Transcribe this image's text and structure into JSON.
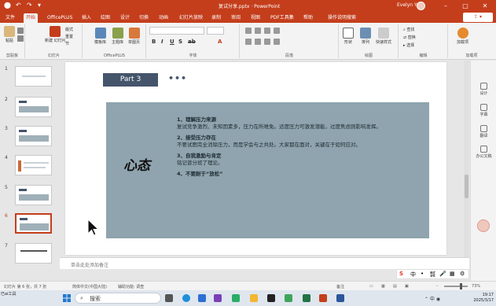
{
  "titlebar": {
    "doc_title": "复试分享.pptx  ·  PowerPoint",
    "user": "Evelyn Yu"
  },
  "tabs": [
    "文件",
    "开始",
    "OfficePLUS",
    "插入",
    "绘图",
    "设计",
    "切换",
    "动画",
    "幻灯片放映",
    "录制",
    "审阅",
    "视图",
    "PDF工具集",
    "帮助",
    "操作说明搜索"
  ],
  "active_tab": "开始",
  "ribbon": {
    "groups": {
      "clipboard": "剪贴板",
      "slides": "幻灯片",
      "officeplus": "OfficePLUS",
      "font": "字体",
      "paragraph": "段落",
      "drawing": "绘图",
      "editing": "编辑",
      "addins": "加载项"
    },
    "buttons": {
      "paste": "粘贴",
      "new_slide": "新建\n幻灯片",
      "layout": "版式",
      "reset": "重置",
      "section": "节",
      "template": "模板库",
      "theme": "主题库",
      "single_page": "单图页",
      "shape": "形状",
      "arrange": "排列",
      "quick_style": "快速样式",
      "find": "查找",
      "replace": "替换",
      "select": "选择",
      "addin": "加载项"
    }
  },
  "thumbnails": [
    {
      "num": "1"
    },
    {
      "num": "2"
    },
    {
      "num": "3"
    },
    {
      "num": "4"
    },
    {
      "num": "5"
    },
    {
      "num": "6"
    },
    {
      "num": "7"
    }
  ],
  "slide": {
    "part": "Part 3",
    "dots": "•••",
    "keyword": "心态",
    "points": [
      {
        "title": "1、理解压力来源",
        "body": "复试竞争激烈、未知因素多，压力在所难免。适度压力可激发潜能，过度焦虑则影响发挥。"
      },
      {
        "title": "2、接受压力存在",
        "body": "不要试图完全消除压力，而是学会与之共处。大家都在面对，关键在于如何应对。"
      },
      {
        "title": "3、自我激励与肯定",
        "body": "铭记曾分班了理论。"
      },
      {
        "title": "4、不要耐于“放松”",
        "body": ""
      }
    ]
  },
  "notes_placeholder": "单击此处添加备注",
  "sidepane": [
    "设计",
    "字幕",
    "翻译",
    "办公文稿"
  ],
  "ime": [
    "S",
    "中",
    "•",
    "㍿",
    "🎤",
    "▦",
    "⚙"
  ],
  "statusbar": {
    "slide_info": "幻灯片 第 6 张，共 7 张",
    "lang": "简体中文(中国大陆)",
    "access": "辅助功能: 调查",
    "notes": "备注",
    "zoom": "73%"
  },
  "taskbar": {
    "search": "搜索",
    "time": "19:17",
    "date": "2025/3/17",
    "label": "已ai工具"
  },
  "colors": {
    "accent": "#c43e1c",
    "slide_box": "#8fa4ae",
    "part_box": "#44546a"
  }
}
